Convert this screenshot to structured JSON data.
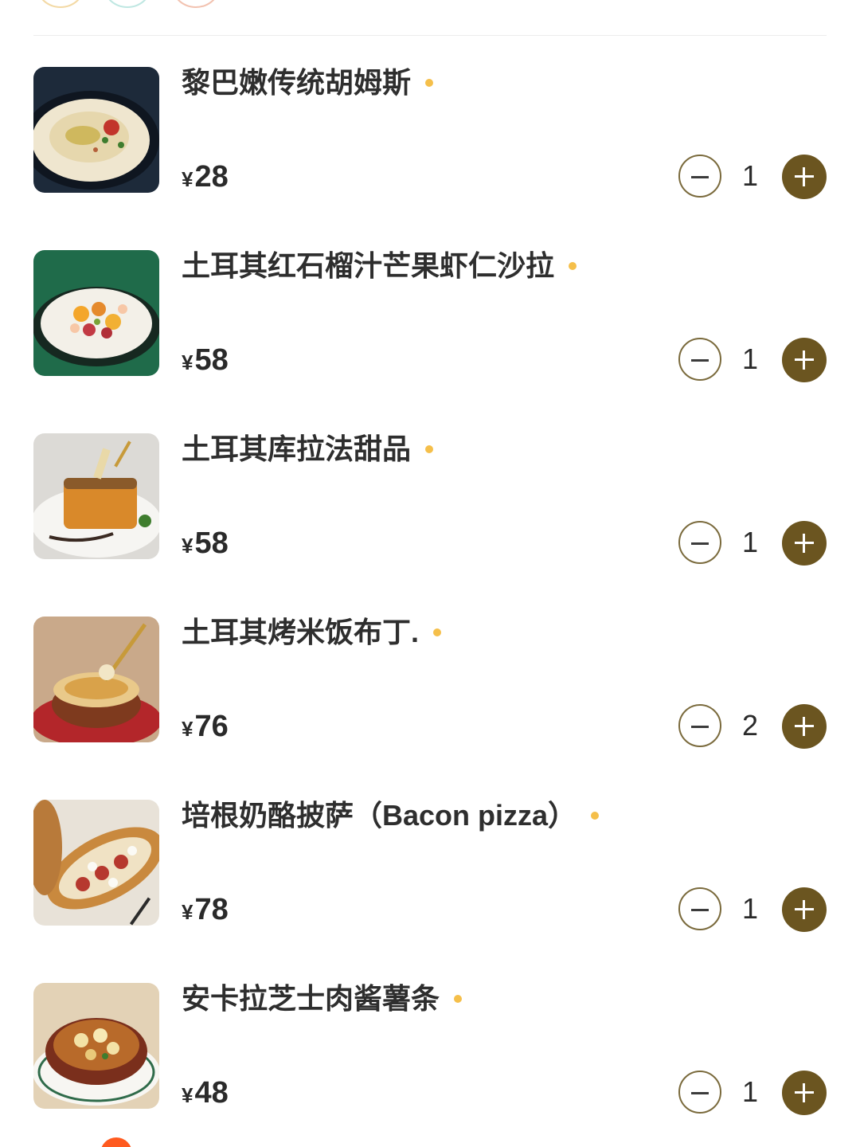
{
  "colors": {
    "accent_brown": "#6b5520",
    "dot_yellow": "#f5bf4a",
    "badge_orange": "#ff5a1f"
  },
  "currency_symbol": "¥",
  "items": [
    {
      "name": "黎巴嫩传统胡姆斯",
      "price": "28",
      "quantity": "1"
    },
    {
      "name": "土耳其红石榴汁芒果虾仁沙拉",
      "price": "58",
      "quantity": "1"
    },
    {
      "name": "土耳其库拉法甜品",
      "price": "58",
      "quantity": "1"
    },
    {
      "name": "土耳其烤米饭布丁.",
      "price": "76",
      "quantity": "2"
    },
    {
      "name": "培根奶酪披萨（Bacon pizza）",
      "price": "78",
      "quantity": "1"
    },
    {
      "name": "安卡拉芝士肉酱薯条",
      "price": "48",
      "quantity": "1"
    }
  ]
}
